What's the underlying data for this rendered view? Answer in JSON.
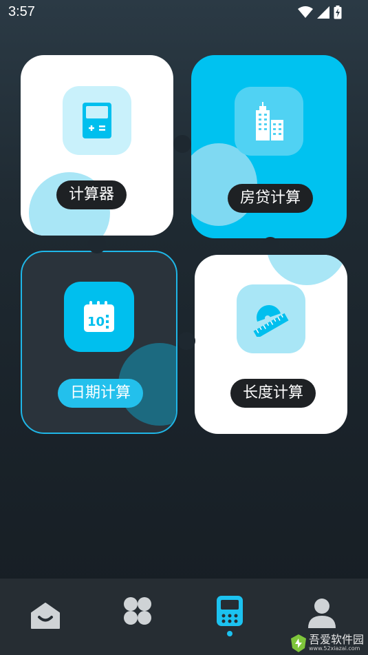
{
  "status_bar": {
    "time": "3:57",
    "icons": [
      "wifi-icon",
      "signal-icon",
      "battery-charging-icon"
    ]
  },
  "cards": [
    {
      "id": "calculator",
      "label": "计算器",
      "icon": "calculator-icon"
    },
    {
      "id": "mortgage",
      "label": "房贷计算",
      "icon": "buildings-icon"
    },
    {
      "id": "date",
      "label": "日期计算",
      "icon": "calendar-icon"
    },
    {
      "id": "length",
      "label": "长度计算",
      "icon": "ruler-protractor-icon"
    }
  ],
  "bottom_nav": {
    "items": [
      {
        "id": "home",
        "icon": "home-icon",
        "active": false
      },
      {
        "id": "apps",
        "icon": "clover-icon",
        "active": false
      },
      {
        "id": "tools",
        "icon": "calculator-tab-icon",
        "active": true
      },
      {
        "id": "profile",
        "icon": "user-icon",
        "active": false
      }
    ]
  },
  "watermark": {
    "title": "吾爱软件园",
    "url": "www.52xiazai.com"
  },
  "colors": {
    "accent": "#00c2f0",
    "dark_pill": "#1e2124",
    "card_white": "#ffffff",
    "card_dark": "#2a333b"
  }
}
